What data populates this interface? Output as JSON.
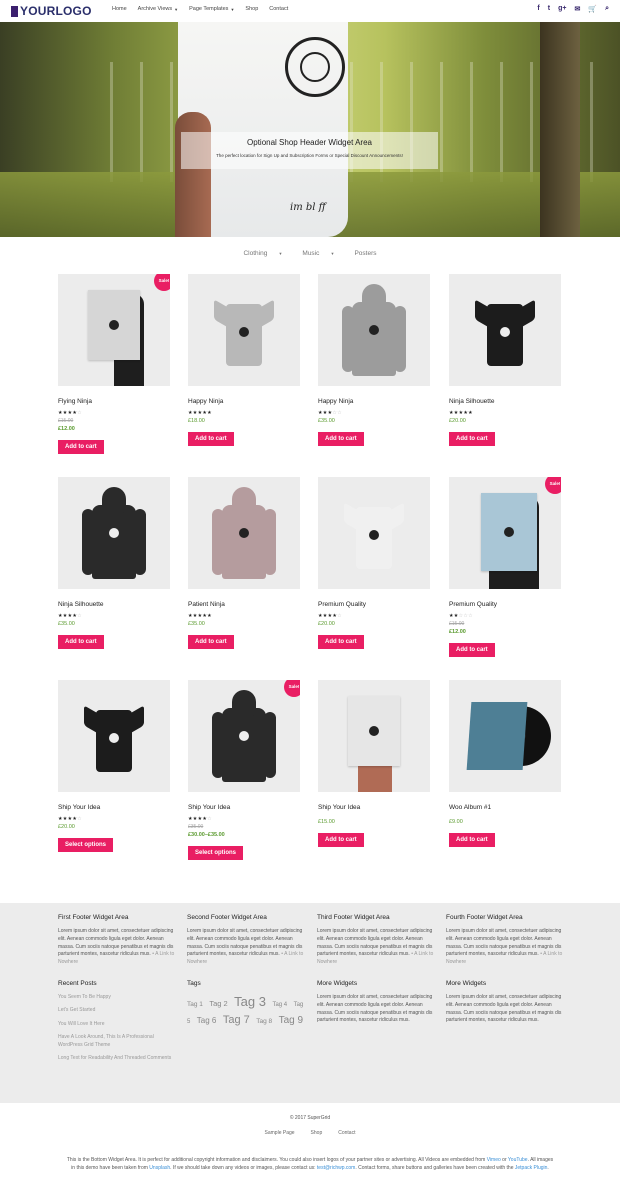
{
  "header": {
    "logo_text": "YOURLOGO",
    "nav": [
      "Home",
      "Archive Views",
      "Page Templates",
      "Shop",
      "Contact"
    ],
    "nav_has_dropdown": [
      false,
      true,
      true,
      false,
      false
    ],
    "social_icons": [
      "facebook-icon",
      "twitter-icon",
      "googleplus-icon",
      "email-icon",
      "cart-icon",
      "search-icon"
    ]
  },
  "hero": {
    "title": "Optional Shop Header Widget Area",
    "subtitle": "The perfect location for Sign Up and Subscription Forms or Special Discount Announcements!",
    "script_text": "im bl ff"
  },
  "category_nav": [
    "Clothing",
    "Music",
    "Posters"
  ],
  "products": [
    {
      "title": "Flying Ninja",
      "rating": 4,
      "old_price": "£15.00",
      "price": "£12.00",
      "sale": true,
      "button": "Add to cart",
      "img": "poster-ninja"
    },
    {
      "title": "Happy Ninja",
      "rating": 5,
      "old_price": "",
      "price": "£18.00",
      "sale": false,
      "button": "Add to cart",
      "img": "tee-grey"
    },
    {
      "title": "Happy Ninja",
      "rating": 3,
      "old_price": "",
      "price": "£35.00",
      "sale": false,
      "button": "Add to cart",
      "img": "hoodie-grey"
    },
    {
      "title": "Ninja Silhouette",
      "rating": 5,
      "old_price": "",
      "price": "£20.00",
      "sale": false,
      "button": "Add to cart",
      "img": "tee-black"
    },
    {
      "title": "Ninja Silhouette",
      "rating": 4,
      "old_price": "",
      "price": "£35.00",
      "sale": false,
      "button": "Add to cart",
      "img": "hoodie-black"
    },
    {
      "title": "Patient Ninja",
      "rating": 5,
      "old_price": "",
      "price": "£35.00",
      "sale": false,
      "button": "Add to cart",
      "img": "hoodie-pink"
    },
    {
      "title": "Premium Quality",
      "rating": 4,
      "old_price": "",
      "price": "£20.00",
      "sale": false,
      "button": "Add to cart",
      "img": "tee-white"
    },
    {
      "title": "Premium Quality",
      "rating": 2,
      "old_price": "£15.00",
      "price": "£12.00",
      "sale": true,
      "button": "Add to cart",
      "img": "poster-woo"
    },
    {
      "title": "Ship Your Idea",
      "rating": 4,
      "old_price": "",
      "price": "£20.00",
      "sale": false,
      "button": "Select options",
      "img": "tee-black-skull"
    },
    {
      "title": "Ship Your Idea",
      "rating": 4,
      "old_price": "£35.00",
      "price": "£30.00–£35.00",
      "sale": true,
      "button": "Select options",
      "img": "hoodie-black-skull"
    },
    {
      "title": "Ship Your Idea",
      "rating": 0,
      "old_price": "",
      "price": "£15.00",
      "sale": false,
      "button": "Add to cart",
      "img": "poster-skull"
    },
    {
      "title": "Woo Album #1",
      "rating": 0,
      "old_price": "",
      "price": "£9.00",
      "sale": false,
      "button": "Add to cart",
      "img": "album"
    }
  ],
  "sale_label": "Sale!",
  "footer": {
    "widgets": [
      {
        "title": "First Footer Widget Area",
        "text": "Lorem ipsum dolor sit amet, consectetuer adipiscing elit. Aenean commodo ligula eget dolor. Aenean massa. Cum sociis natoque penatibus et magnis dis parturient montes, nascetur ridiculus mus.",
        "link": "• A Link to Nowhere"
      },
      {
        "title": "Second Footer Widget Area",
        "text": "Lorem ipsum dolor sit amet, consectetuer adipiscing elit. Aenean commodo ligula eget dolor. Aenean massa. Cum sociis natoque penatibus et magnis dis parturient montes, nascetur ridiculus mus.",
        "link": "• A Link to Nowhere"
      },
      {
        "title": "Third Footer Widget Area",
        "text": "Lorem ipsum dolor sit amet, consectetuer adipiscing elit. Aenean commodo ligula eget dolor. Aenean massa. Cum sociis natoque penatibus et magnis dis parturient montes, nascetur ridiculus mus.",
        "link": "• A Link to Nowhere"
      },
      {
        "title": "Fourth Footer Widget Area",
        "text": "Lorem ipsum dolor sit amet, consectetuer adipiscing elit. Aenean commodo ligula eget dolor. Aenean massa. Cum sociis natoque penatibus et magnis dis parturient montes, nascetur ridiculus mus.",
        "link": "• A Link to Nowhere"
      }
    ],
    "recent_posts_title": "Recent Posts",
    "recent_posts": [
      "You Seem To Be Happy",
      "Let's Get Started",
      "You Will Love It Here",
      "Have A Look Around, This Is A Professional WordPress Grid Theme",
      "Long Text for Readability And Threaded Comments"
    ],
    "tags_title": "Tags",
    "tags": [
      {
        "label": "Tag 1",
        "size": 6.5
      },
      {
        "label": "Tag 2",
        "size": 7.5
      },
      {
        "label": "Tag 3",
        "size": 13
      },
      {
        "label": "Tag 4",
        "size": 6
      },
      {
        "label": "Tag 5",
        "size": 6
      },
      {
        "label": "Tag 6",
        "size": 8
      },
      {
        "label": "Tag 7",
        "size": 11
      },
      {
        "label": "Tag 8",
        "size": 6.5
      },
      {
        "label": "Tag 9",
        "size": 10
      }
    ],
    "more_widgets_title": "More Widgets",
    "more_widgets_text": "Lorem ipsum dolor sit amet, consectetuer adipiscing elit. Aenean commodo ligula eget dolor. Aenean massa. Cum sociis natoque penatibus et magnis dis parturient montes, nascetur ridiculus mus."
  },
  "bottom": {
    "copyright": "© 2017 SuperGrid",
    "nav": [
      "Sample Page",
      "Shop",
      "Contact"
    ],
    "note_1": "This is the Bottom Widget Area. It is perfect for additional copyright information and disclaimers. You could also insert logos of your partner sites or advertising. All Videos are embedded from ",
    "vimeo": "Vimeo",
    "or": " or ",
    "youtube": "YouTube",
    "note_2": ". All images in this demo have been taken from ",
    "unsplash": "Unsplash",
    "note_3": ". If we should take down any videos or images, please contact us: ",
    "email": "test@richwp.com",
    "note_4": ". Contact forms, share buttons and galleries have been created with the ",
    "jetpack": "Jetpack Plugin",
    "note_5": "."
  }
}
